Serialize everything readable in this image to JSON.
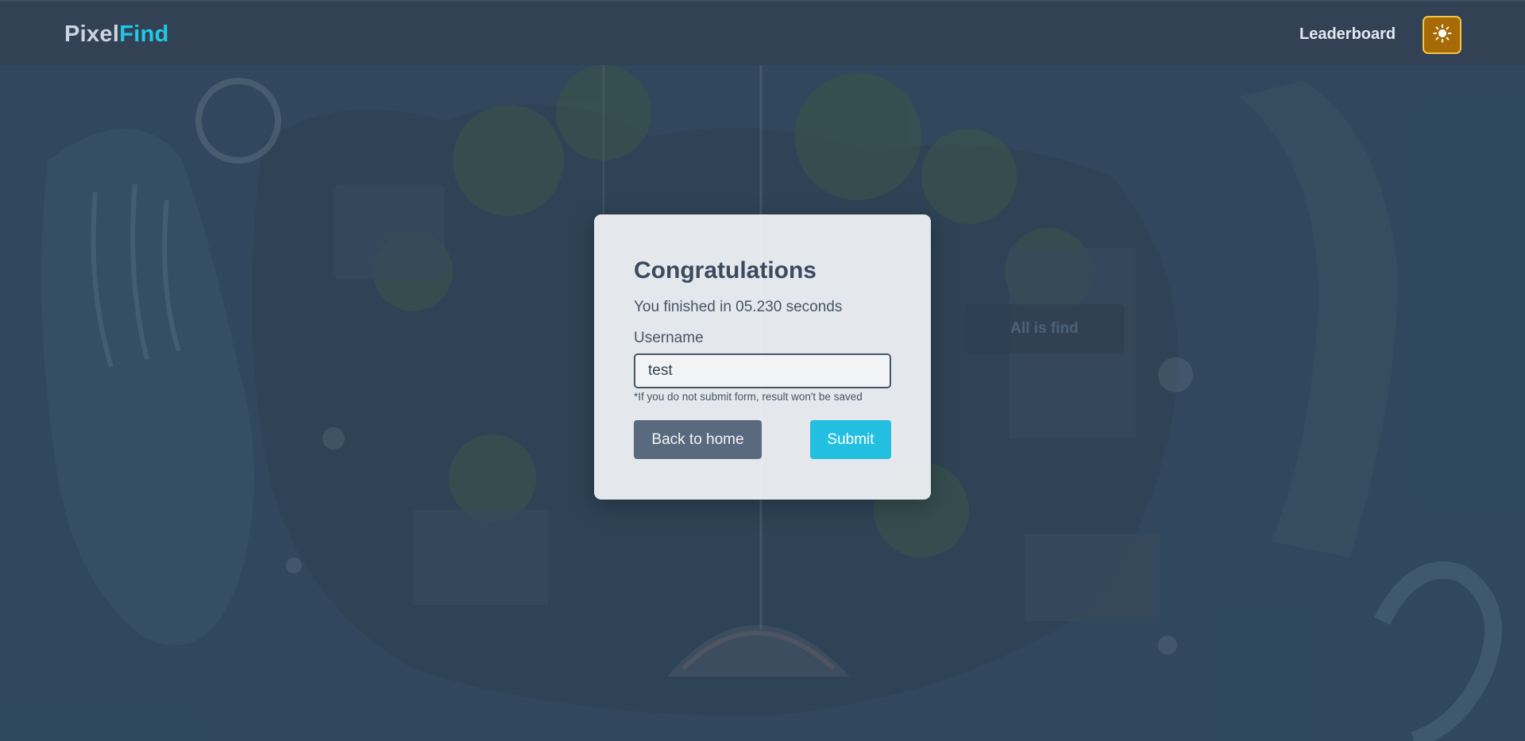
{
  "header": {
    "brand_part1": "Pixel",
    "brand_part2": "Find",
    "leaderboard_label": "Leaderboard",
    "theme_toggle_icon": "sun-icon"
  },
  "background": {
    "hint_button_label": "All is find"
  },
  "modal": {
    "title": "Congratulations",
    "result_text": "You finished in 05.230 seconds",
    "username_label": "Username",
    "username_value": "test",
    "hint": "*If you do not submit form, result won't be saved",
    "back_label": "Back to home",
    "submit_label": "Submit"
  },
  "colors": {
    "navbar": "#334155",
    "brand_accent": "#22c9e6",
    "submit": "#22bfe0",
    "back": "#5a6a7e",
    "theme_button": "#a86a06"
  }
}
